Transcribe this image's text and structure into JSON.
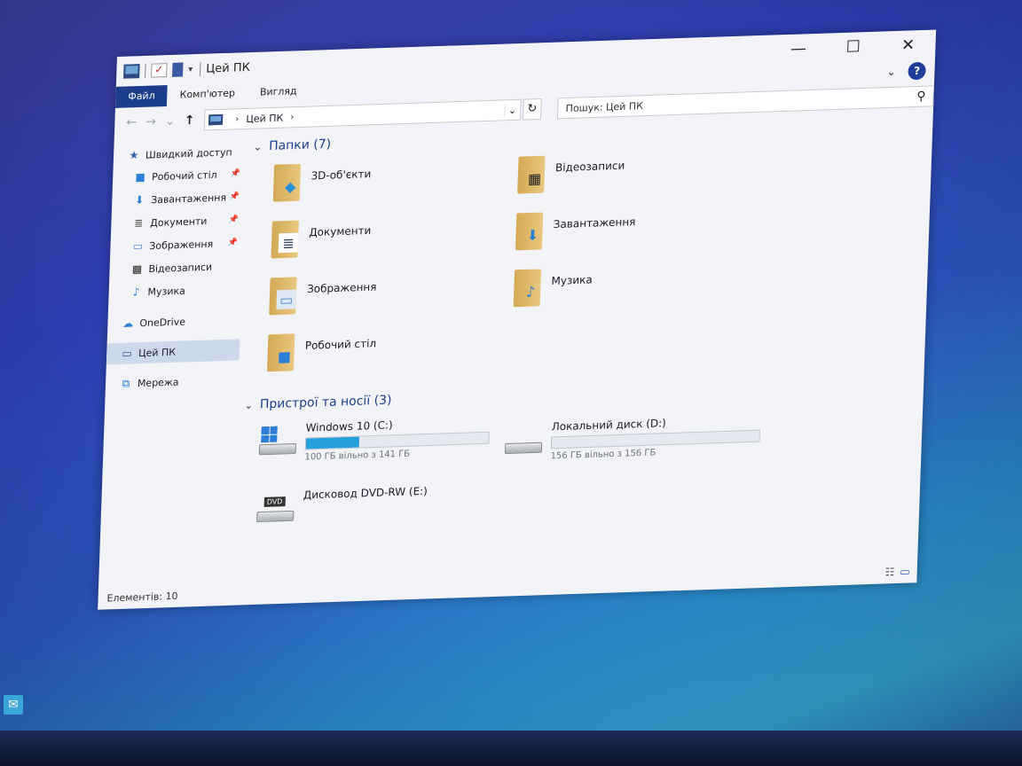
{
  "window": {
    "title": "Цей ПК",
    "controls": {
      "minimize": "—",
      "maximize": "☐",
      "close": "✕"
    }
  },
  "ribbon": {
    "tabs": [
      "Файл",
      "Комп'ютер",
      "Вигляд"
    ],
    "expand_icon": "chevron-down-icon",
    "help": "?"
  },
  "address": {
    "back": "←",
    "forward": "→",
    "recent": "⌄",
    "up": "↑",
    "path": [
      "Цей ПК"
    ],
    "separator": "›",
    "dropdown": "⌄",
    "refresh": "↻",
    "search_placeholder": "Пошук: Цей ПК"
  },
  "sidebar": {
    "quick_access": "Швидкий доступ",
    "pinned": [
      {
        "label": "Робочий стіл",
        "icon": "desktop-icon",
        "pinned": true
      },
      {
        "label": "Завантаження",
        "icon": "download-icon",
        "pinned": true
      },
      {
        "label": "Документи",
        "icon": "document-icon",
        "pinned": true
      },
      {
        "label": "Зображення",
        "icon": "pictures-icon",
        "pinned": true
      },
      {
        "label": "Відеозаписи",
        "icon": "video-icon",
        "pinned": false
      },
      {
        "label": "Музика",
        "icon": "music-icon",
        "pinned": false
      }
    ],
    "onedrive": "OneDrive",
    "this_pc": "Цей ПК",
    "network": "Мережа",
    "pin_glyph": "📌"
  },
  "content": {
    "folders_header": "Папки (7)",
    "folders": [
      {
        "label": "3D-об'єкти",
        "icon": "3d-objects-icon",
        "glyph": "◆",
        "color": "#2a8fd6"
      },
      {
        "label": "Документи",
        "icon": "documents-icon",
        "glyph": "≣",
        "color": "#33445e"
      },
      {
        "label": "Зображення",
        "icon": "pictures-icon",
        "glyph": "▭",
        "color": "#4a87c6"
      },
      {
        "label": "Робочий стіл",
        "icon": "desktop-icon",
        "glyph": "■",
        "color": "#2b7fd6"
      },
      {
        "label": "Відеозаписи",
        "icon": "videos-icon",
        "glyph": "▦",
        "color": "#222"
      },
      {
        "label": "Завантаження",
        "icon": "downloads-icon",
        "glyph": "⬇",
        "color": "#2b7fd6"
      },
      {
        "label": "Музика",
        "icon": "music-icon",
        "glyph": "♪",
        "color": "#2b7fd6"
      }
    ],
    "devices_header": "Пристрої та носії (3)",
    "drives": [
      {
        "name": "Windows 10 (C:)",
        "free": "100 ГБ вільно з 141 ГБ",
        "used_fraction": 0.29,
        "icon": "windows-drive-icon"
      },
      {
        "name": "Дисковод DVD-RW (E:)",
        "icon": "dvd-drive-icon",
        "tag": "DVD"
      },
      {
        "name": "Локальний диск (D:)",
        "free": "156 ГБ вільно з 156 ГБ",
        "used_fraction": 0.0,
        "icon": "hard-drive-icon"
      }
    ]
  },
  "status": {
    "items": "Елементів: 10"
  },
  "view": {
    "details": "☷",
    "tiles": "▭"
  }
}
